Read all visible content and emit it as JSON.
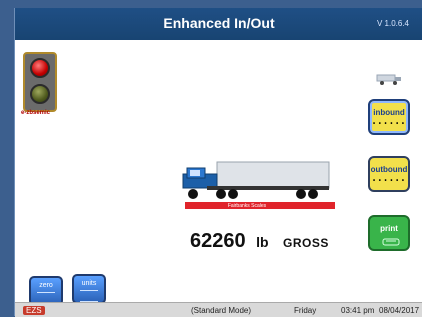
{
  "app": {
    "title": "Enhanced In/Out",
    "version": "V 1.0.6.4"
  },
  "left": {
    "brand": "e-zbsemic"
  },
  "buttons": {
    "inbound": "inbound",
    "outbound": "outbound",
    "print": "print",
    "zero": "zero",
    "units": "units"
  },
  "scale": {
    "label": "Fairbanks Scales",
    "weight_value": "62260",
    "weight_unit": "lb",
    "weight_mode": "GROSS"
  },
  "status": {
    "left_badge": "EZS",
    "mode": "(Standard Mode)",
    "day": "Friday",
    "time": "03:41 pm",
    "date": "08/04/2017"
  },
  "colors": {
    "frame_blue": "#2a4f7f",
    "topbar_blue": "#1f4f85",
    "button_yellow": "#f2e04b",
    "button_green": "#39b44a",
    "scale_red": "#e0242b"
  }
}
